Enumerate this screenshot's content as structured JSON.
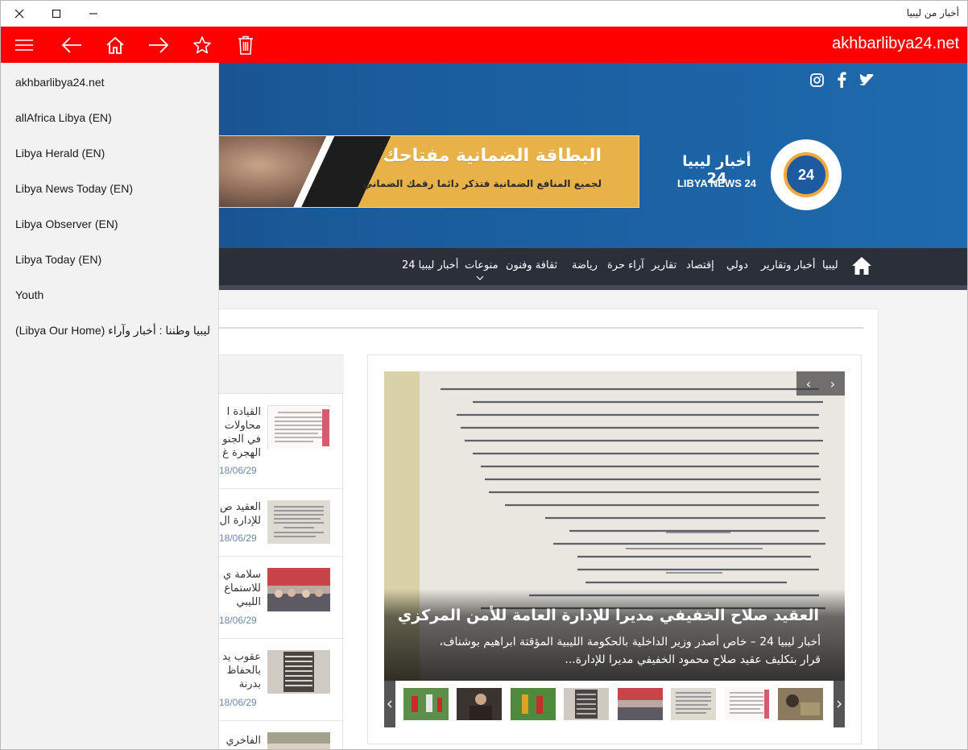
{
  "window": {
    "title": "أخبار من ليبيا"
  },
  "appbar": {
    "site_url": "akhbarlibya24.net",
    "color": "#fe0000",
    "icons": [
      "hamburger-icon",
      "back-arrow-icon",
      "home-icon",
      "forward-arrow-icon",
      "star-icon",
      "trash-icon"
    ]
  },
  "drawer": {
    "items": [
      {
        "label": "akhbarlibya24.net"
      },
      {
        "label": "allAfrica Libya (EN)"
      },
      {
        "label": "Libya Herald (EN)"
      },
      {
        "label": "Libya News Today (EN)"
      },
      {
        "label": "Libya Observer (EN)"
      },
      {
        "label": "Libya Today (EN)"
      },
      {
        "label": "Youth"
      },
      {
        "label": "ليبيا وطننا : أخبار وآراء (Libya Our Home)"
      }
    ]
  },
  "site": {
    "social_icons": [
      "instagram-icon",
      "facebook-icon",
      "twitter-icon"
    ],
    "banner": {
      "title": "البطاقة الضمانية مفتاحك",
      "subtitle": "لجميع المنافع الضمانية فتذكر دائما رقمك الضماني"
    },
    "logo": {
      "mark": "24",
      "name_ar": "أخبار ليبيا 24",
      "name_en": "LIBYA NEWS 24"
    },
    "nav": {
      "items": [
        {
          "label": "ليبيا"
        },
        {
          "label": "أخبار وتقارير"
        },
        {
          "label": "دولي"
        },
        {
          "label": "إقتصاد"
        },
        {
          "label": "تقارير"
        },
        {
          "label": "آراء حرة"
        },
        {
          "label": "رياضة"
        },
        {
          "label": "ثقافة وفنون"
        },
        {
          "label": "منوعات"
        },
        {
          "label": "أخبار ليبيا 24"
        }
      ]
    },
    "news_list": [
      {
        "title": "القيادة ا محاولات في الجنو الهجرة غ",
        "date": "18/06/29"
      },
      {
        "title": "العقيد ص للإدارة ال",
        "date": "18/06/29"
      },
      {
        "title": "سلامة ي للاستماع الليبي",
        "date": "18/06/29"
      },
      {
        "title": "عقوب يد بالحفاظ بدرنة",
        "date": "18/06/29"
      },
      {
        "title": "الفاخري خلال الح",
        "date": ""
      }
    ],
    "slider": {
      "title": "العقيد صلاح الخفيفي مديرا للإدارة العامة للأمن المركزي",
      "description": "أخبار ليبيا 24 – خاص أصدر وزير الداخلية بالحكومة الليبية المؤقتة ابراهيم بوشناف، قرار بتكليف عقيد صلاح محمود الخفيفي مديرا للإدارة...",
      "prev": "‹",
      "next": "›"
    }
  }
}
